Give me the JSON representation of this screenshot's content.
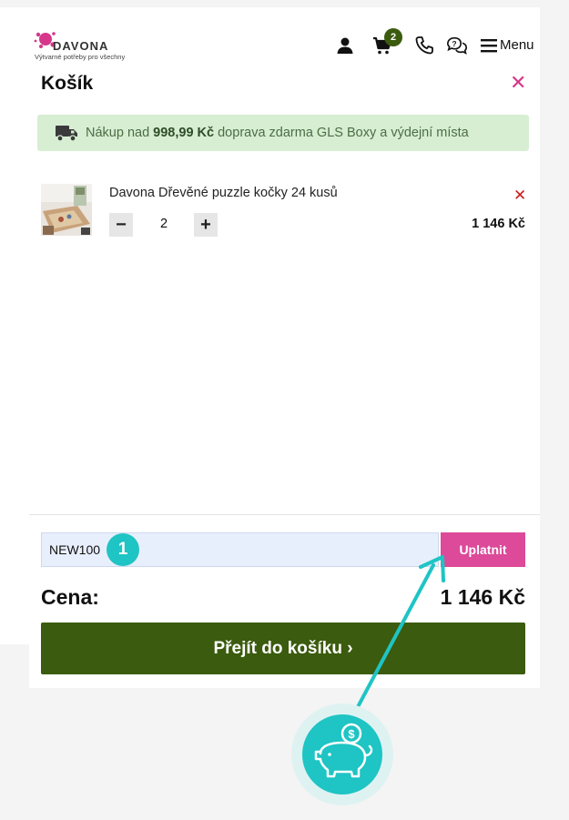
{
  "header": {
    "logo_name": "DAVONA",
    "logo_tagline": "Výtvarné potřeby pro všechny",
    "cart_count": "2",
    "menu_label": "Menu"
  },
  "cart": {
    "title": "Košík",
    "shipping": {
      "prefix": "Nákup nad ",
      "amount": "998,99 Kč",
      "suffix": " doprava zdarma GLS Boxy a výdejní místa"
    },
    "items": [
      {
        "name": "Davona Dřevěné puzzle kočky 24 kusů",
        "quantity": "2",
        "price": "1 146 Kč"
      }
    ],
    "coupon": {
      "value": "NEW100",
      "apply_label": "Uplatnit"
    },
    "step_number": "1",
    "total_label": "Cena:",
    "total_value": "1 146 Kč",
    "checkout_label": "Přejít do košíku ›"
  },
  "colors": {
    "accent_pink": "#dc4a99",
    "primary_green": "#3b5b0e",
    "teal": "#1fc4c4",
    "shipping_bg": "#d7eed3"
  },
  "icons": [
    "user-icon",
    "cart-icon",
    "phone-icon",
    "chat-icon",
    "menu-icon",
    "truck-icon",
    "piggy-bank-icon",
    "arrow-pointer"
  ]
}
